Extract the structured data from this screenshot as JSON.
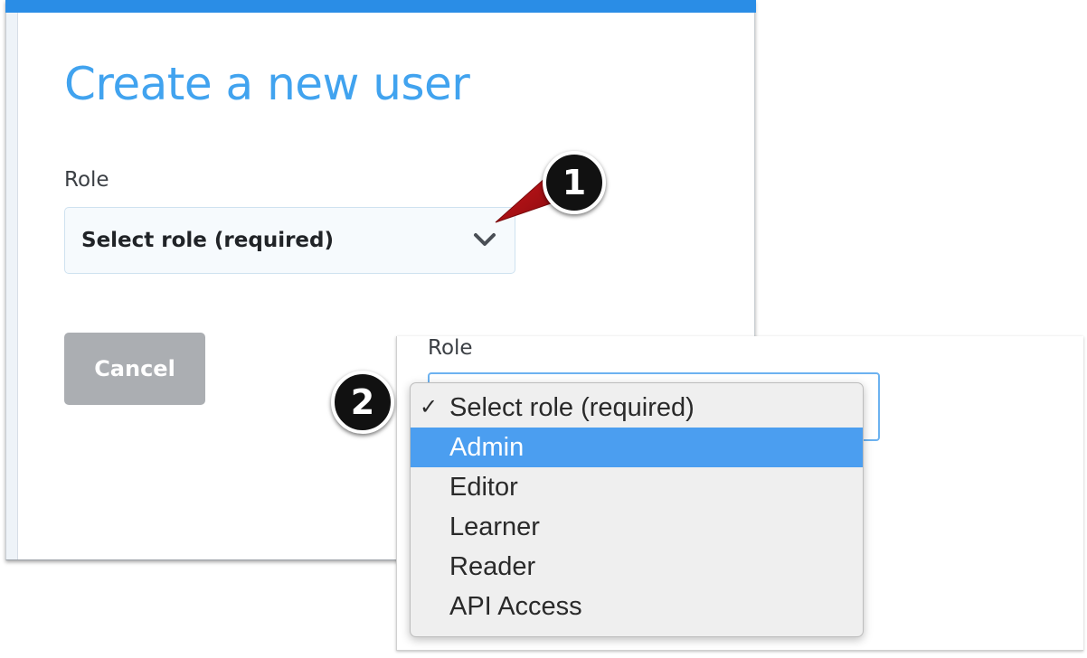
{
  "dialog": {
    "title": "Create a new user",
    "role_label": "Role",
    "role_select": {
      "selected_value": "Select role (required)",
      "icon": "chevron-down-icon"
    },
    "cancel_label": "Cancel"
  },
  "callouts": {
    "step1": "1",
    "step2": "2",
    "arrow_color": "#b30f14"
  },
  "dropdown_inset": {
    "role_label": "Role",
    "options": [
      {
        "label": "Select role (required)",
        "checked": true,
        "highlighted": false
      },
      {
        "label": "Admin",
        "checked": false,
        "highlighted": true
      },
      {
        "label": "Editor",
        "checked": false,
        "highlighted": false
      },
      {
        "label": "Learner",
        "checked": false,
        "highlighted": false
      },
      {
        "label": "Reader",
        "checked": false,
        "highlighted": false
      },
      {
        "label": "API Access",
        "checked": false,
        "highlighted": false
      }
    ],
    "check_mark": "✓"
  },
  "colors": {
    "accent": "#2a8de6",
    "title": "#41a3ef",
    "highlight": "#4b9ef0",
    "cancel_button": "#abaeb2"
  }
}
